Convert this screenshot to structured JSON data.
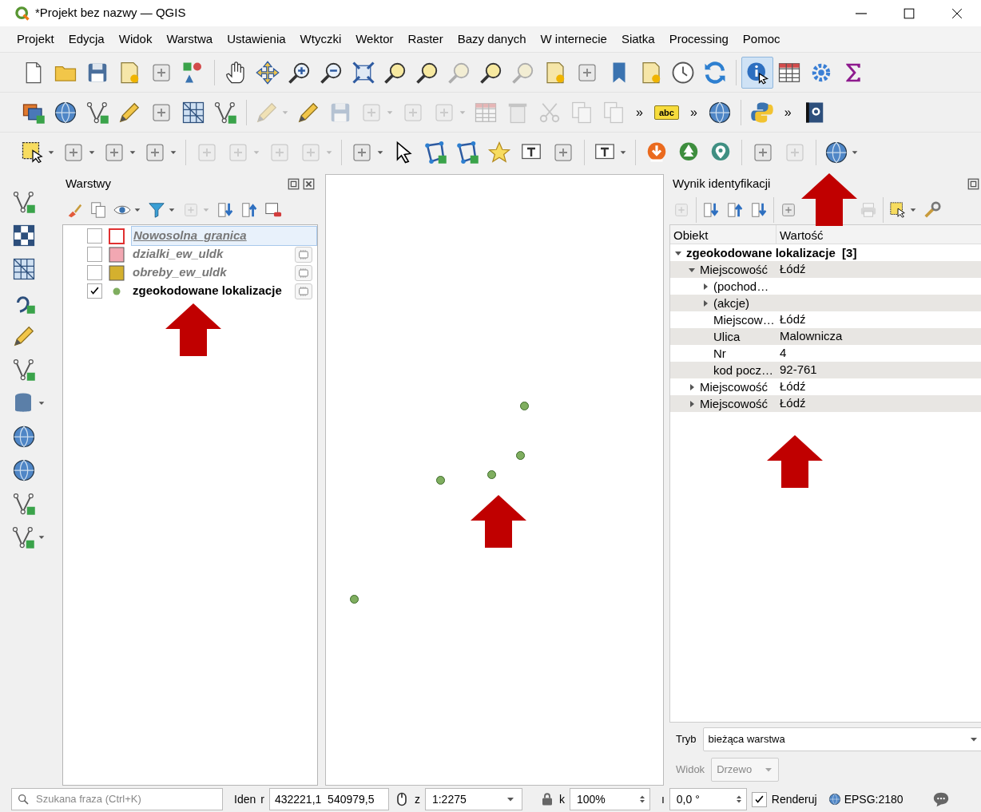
{
  "window": {
    "title": "*Projekt bez nazwy — QGIS"
  },
  "menu": [
    "Projekt",
    "Edycja",
    "Widok",
    "Warstwa",
    "Ustawienia",
    "Wtyczki",
    "Wektor",
    "Raster",
    "Bazy danych",
    "W internecie",
    "Siatka",
    "Processing",
    "Pomoc"
  ],
  "toolbars": [
    [
      {
        "kind": "page",
        "disabled": false,
        "pressed": false
      },
      {
        "kind": "folder",
        "disabled": false,
        "pressed": false
      },
      {
        "kind": "disk",
        "disabled": false,
        "pressed": false
      },
      {
        "kind": "layout",
        "disabled": false,
        "pressed": false
      },
      {
        "kind": "generic",
        "disabled": false,
        "pressed": false
      },
      {
        "kind": "shapes",
        "disabled": false,
        "pressed": false
      },
      {
        "kind": "separator"
      },
      {
        "kind": "hand",
        "disabled": false,
        "pressed": false
      },
      {
        "kind": "move",
        "disabled": false,
        "pressed": false
      },
      {
        "kind": "zoomin",
        "disabled": false,
        "pressed": false
      },
      {
        "kind": "zoomout",
        "disabled": false,
        "pressed": false
      },
      {
        "kind": "fullextent",
        "disabled": false,
        "pressed": false
      },
      {
        "kind": "magnifier",
        "disabled": false,
        "pressed": false
      },
      {
        "kind": "magnifier",
        "disabled": false,
        "pressed": false
      },
      {
        "kind": "magnifier",
        "disabled": true,
        "pressed": false
      },
      {
        "kind": "magnifier",
        "disabled": false,
        "pressed": false
      },
      {
        "kind": "magnifier",
        "disabled": true,
        "pressed": false
      },
      {
        "kind": "layout",
        "disabled": false,
        "pressed": false
      },
      {
        "kind": "generic",
        "disabled": false,
        "pressed": false
      },
      {
        "kind": "bookmark",
        "disabled": false,
        "pressed": false
      },
      {
        "kind": "layout",
        "disabled": false,
        "pressed": false
      },
      {
        "kind": "clock",
        "disabled": false,
        "pressed": false
      },
      {
        "kind": "refresh",
        "disabled": false,
        "pressed": false
      },
      {
        "kind": "separator"
      },
      {
        "kind": "identify",
        "disabled": false,
        "pressed": true
      },
      {
        "kind": "table",
        "disabled": false,
        "pressed": false
      },
      {
        "kind": "gear",
        "disabled": false,
        "pressed": false
      },
      {
        "kind": "sigma",
        "disabled": false,
        "pressed": false
      }
    ],
    [
      {
        "kind": "layers",
        "disabled": false,
        "pressed": false
      },
      {
        "kind": "globe",
        "disabled": false,
        "pressed": false
      },
      {
        "kind": "vertex",
        "disabled": false,
        "pressed": false
      },
      {
        "kind": "pencil",
        "disabled": false,
        "pressed": false
      },
      {
        "kind": "generic",
        "disabled": false,
        "pressed": false
      },
      {
        "kind": "grid",
        "disabled": false,
        "pressed": false
      },
      {
        "kind": "vertex",
        "disabled": false,
        "pressed": false
      },
      {
        "kind": "separator"
      },
      {
        "kind": "pencil",
        "disabled": true,
        "pressed": false,
        "dropdown": true
      },
      {
        "kind": "pencil",
        "disabled": false,
        "pressed": false
      },
      {
        "kind": "disk",
        "disabled": true,
        "pressed": false
      },
      {
        "kind": "generic",
        "disabled": true,
        "pressed": false,
        "dropdown": true
      },
      {
        "kind": "generic",
        "disabled": true,
        "pressed": false
      },
      {
        "kind": "generic",
        "disabled": true,
        "pressed": false,
        "dropdown": true
      },
      {
        "kind": "table",
        "disabled": true,
        "pressed": false
      },
      {
        "kind": "trash",
        "disabled": true,
        "pressed": false
      },
      {
        "kind": "scissors",
        "disabled": true,
        "pressed": false
      },
      {
        "kind": "copy",
        "disabled": true,
        "pressed": false
      },
      {
        "kind": "copy",
        "disabled": true,
        "pressed": false
      },
      {
        "kind": "overflow",
        "label": "»"
      },
      {
        "kind": "tag",
        "label": "abc",
        "disabled": false,
        "pressed": false
      },
      {
        "kind": "overflow",
        "label": "»"
      },
      {
        "kind": "globe",
        "disabled": false,
        "pressed": false
      },
      {
        "kind": "separator"
      },
      {
        "kind": "snake",
        "disabled": false,
        "pressed": false
      },
      {
        "kind": "overflow",
        "label": "»"
      },
      {
        "kind": "help",
        "disabled": false,
        "pressed": false
      }
    ],
    [
      {
        "kind": "select",
        "disabled": false,
        "pressed": false,
        "dropdown": true
      },
      {
        "kind": "generic",
        "disabled": false,
        "pressed": false,
        "dropdown": true
      },
      {
        "kind": "generic",
        "disabled": false,
        "pressed": false,
        "dropdown": true
      },
      {
        "kind": "generic",
        "disabled": false,
        "pressed": false,
        "dropdown": true
      },
      {
        "kind": "separator"
      },
      {
        "kind": "generic",
        "disabled": true,
        "pressed": false
      },
      {
        "kind": "generic",
        "disabled": true,
        "pressed": false,
        "dropdown": true
      },
      {
        "kind": "generic",
        "disabled": true,
        "pressed": false
      },
      {
        "kind": "generic",
        "disabled": true,
        "pressed": false,
        "dropdown": true
      },
      {
        "kind": "separator"
      },
      {
        "kind": "generic",
        "disabled": false,
        "pressed": false,
        "dropdown": true
      },
      {
        "kind": "cursor",
        "disabled": false,
        "pressed": false
      },
      {
        "kind": "polygon",
        "disabled": false,
        "pressed": false
      },
      {
        "kind": "polygon",
        "disabled": false,
        "pressed": false
      },
      {
        "kind": "star",
        "disabled": false,
        "pressed": false
      },
      {
        "kind": "text",
        "disabled": false,
        "pressed": false
      },
      {
        "kind": "generic",
        "disabled": false,
        "pressed": false
      },
      {
        "kind": "separator"
      },
      {
        "kind": "text",
        "disabled": false,
        "pressed": false,
        "dropdown": true
      },
      {
        "kind": "separator"
      },
      {
        "kind": "badgedown",
        "disabled": false,
        "pressed": false
      },
      {
        "kind": "badgetree",
        "disabled": false,
        "pressed": false
      },
      {
        "kind": "badgepin",
        "disabled": false,
        "pressed": false
      },
      {
        "kind": "separator"
      },
      {
        "kind": "generic",
        "disabled": false,
        "pressed": false
      },
      {
        "kind": "generic",
        "disabled": true,
        "pressed": false
      },
      {
        "kind": "separator"
      },
      {
        "kind": "globe",
        "disabled": false,
        "pressed": false,
        "dropdown": true
      }
    ]
  ],
  "side_toolbar": [
    {
      "kind": "vertex",
      "disabled": false,
      "pressed": false
    },
    {
      "kind": "checker",
      "disabled": false,
      "pressed": false
    },
    {
      "kind": "grid",
      "disabled": false,
      "pressed": false
    },
    {
      "kind": "curve",
      "disabled": false,
      "pressed": false
    },
    {
      "kind": "pencil",
      "disabled": false,
      "pressed": false
    },
    {
      "kind": "vertex",
      "disabled": false,
      "pressed": false
    },
    {
      "kind": "database",
      "disabled": false,
      "pressed": false,
      "dropdown": true
    },
    {
      "kind": "globe",
      "disabled": false,
      "pressed": false
    },
    {
      "kind": "globe",
      "disabled": false,
      "pressed": false
    },
    {
      "kind": "vertex",
      "disabled": false,
      "pressed": false
    },
    {
      "kind": "vertex",
      "disabled": false,
      "pressed": false,
      "dropdown": true
    }
  ],
  "layers_panel": {
    "title": "Warstwy",
    "toolbar": [
      {
        "kind": "brush",
        "disabled": false,
        "pressed": false
      },
      {
        "kind": "copy",
        "disabled": false,
        "pressed": false
      },
      {
        "kind": "eye",
        "disabled": false,
        "pressed": false,
        "dropdown": true
      },
      {
        "kind": "filter",
        "disabled": false,
        "pressed": false,
        "dropdown": true
      },
      {
        "kind": "generic",
        "disabled": true,
        "pressed": false,
        "dropdown": true
      },
      {
        "kind": "expand",
        "disabled": false,
        "pressed": false
      },
      {
        "kind": "collapse",
        "disabled": false,
        "pressed": false
      },
      {
        "kind": "remove",
        "disabled": false,
        "pressed": false
      }
    ],
    "layers": [
      {
        "name": "Nowosolna_granica",
        "checked": false,
        "selected": true,
        "kind": "outline",
        "color": "#e03030",
        "indicator": false
      },
      {
        "name": "dzialki_ew_uldk",
        "checked": false,
        "selected": false,
        "kind": "fill",
        "color": "#f2a7b2",
        "indicator": true
      },
      {
        "name": "obreby_ew_uldk",
        "checked": false,
        "selected": false,
        "kind": "fill",
        "color": "#d4b02e",
        "indicator": true
      },
      {
        "name": "zgeokodowane lokalizacje",
        "checked": true,
        "selected": false,
        "kind": "point",
        "color": "#7fae5f",
        "indicator": true
      }
    ]
  },
  "identify": {
    "title": "Wynik identyfikacji",
    "toolbar": [
      {
        "kind": "generic",
        "disabled": true,
        "pressed": false
      },
      {
        "kind": "separator"
      },
      {
        "kind": "expand",
        "disabled": false,
        "pressed": false
      },
      {
        "kind": "collapse",
        "disabled": false,
        "pressed": false
      },
      {
        "kind": "expand",
        "disabled": false,
        "pressed": false
      },
      {
        "kind": "separator"
      },
      {
        "kind": "generic",
        "disabled": false,
        "pressed": false
      },
      {
        "kind": "print",
        "disabled": true,
        "pressed": false
      },
      {
        "kind": "separator"
      },
      {
        "kind": "select",
        "disabled": false,
        "pressed": false,
        "dropdown": true
      },
      {
        "kind": "wrench",
        "disabled": false,
        "pressed": false
      }
    ],
    "columns": [
      "Obiekt",
      "Wartość"
    ],
    "tree": [
      {
        "label": "zgeokodowane lokalizacje  [3]",
        "expanded": true,
        "children": [
          {
            "label": "Miejscowość",
            "value": "Łódź",
            "expanded": true,
            "children": [
              {
                "label": "(pochod…",
                "expanded": false
              },
              {
                "label": "(akcje)",
                "expanded": false
              },
              {
                "label": "Miejscow…",
                "value": "Łódź"
              },
              {
                "label": "Ulica",
                "value": "Malownicza"
              },
              {
                "label": "Nr",
                "value": "4"
              },
              {
                "label": "kod pocz…",
                "value": "92-761"
              }
            ]
          },
          {
            "label": "Miejscowość",
            "value": "Łódź",
            "expanded": false
          },
          {
            "label": "Miejscowość",
            "value": "Łódź",
            "expanded": false
          }
        ]
      }
    ],
    "mode": {
      "label": "Tryb",
      "value": "bieżąca warstwa"
    },
    "view": {
      "label": "Widok",
      "value": "Drzewo",
      "disabled": true
    }
  },
  "status_bar": {
    "search_placeholder": "Szukana fraza (Ctrl+K)",
    "cut_label": "Iden",
    "coordinate_label": "r",
    "coordinate": "432221,1  540979,5",
    "scale_label": "z",
    "scale": "1:2275",
    "magnifier_label": "k",
    "magnifier": "100%",
    "rotation_label": "ı",
    "rotation": "0,0 °",
    "render": {
      "label": "Renderuj",
      "checked": true
    },
    "crs": "EPSG:2180"
  }
}
